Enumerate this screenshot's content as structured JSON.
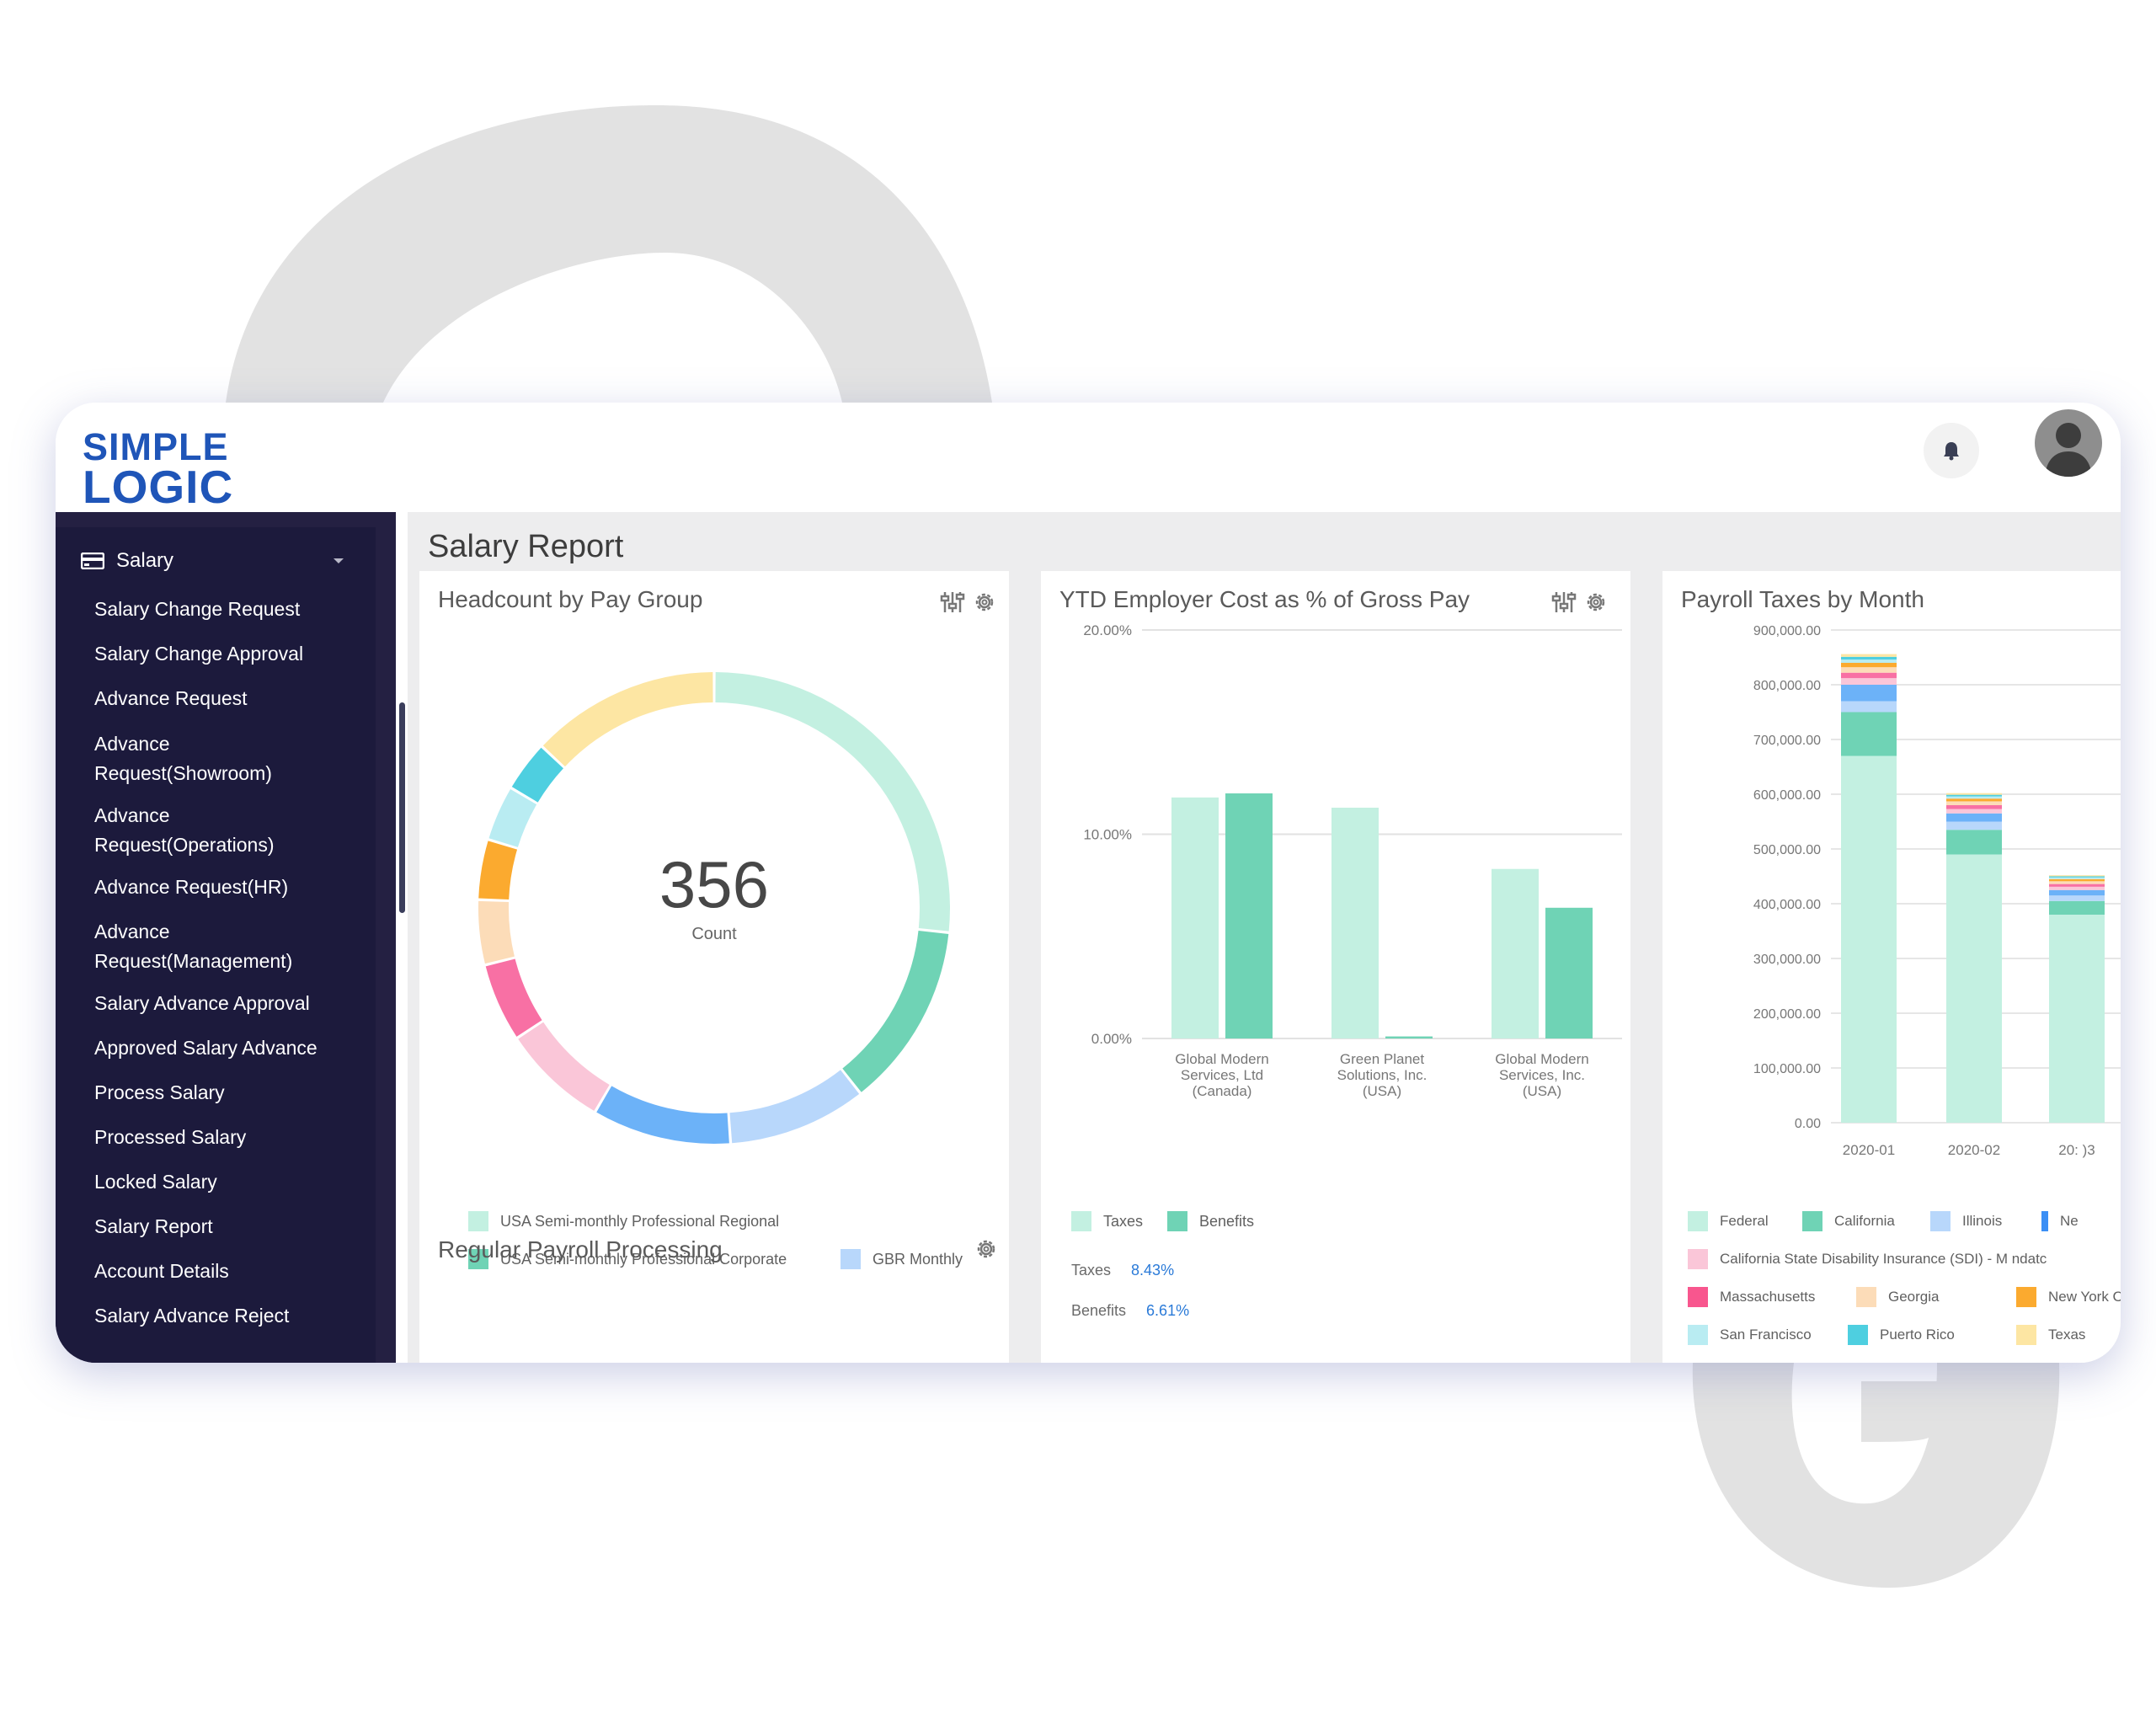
{
  "brand": {
    "line1": "SIMPLE",
    "line2": "LOGIC",
    "color": "#1f55b8"
  },
  "header": {
    "notifications_icon": "bell-icon",
    "avatar_icon": "user-avatar"
  },
  "sidebar": {
    "section": {
      "label": "Salary",
      "icon": "credit-card-icon"
    },
    "items": [
      {
        "label": "Salary Change Request"
      },
      {
        "label": "Salary Change Approval"
      },
      {
        "label": "Advance Request"
      },
      {
        "label": "Advance\nRequest(Showroom)"
      },
      {
        "label": "Advance\nRequest(Operations)"
      },
      {
        "label": "Advance Request(HR)"
      },
      {
        "label": "Advance\nRequest(Management)"
      },
      {
        "label": "Salary Advance Approval"
      },
      {
        "label": "Approved Salary Advance"
      },
      {
        "label": "Process Salary"
      },
      {
        "label": "Processed Salary"
      },
      {
        "label": "Locked Salary"
      },
      {
        "label": "Salary Report"
      },
      {
        "label": "Account Details"
      },
      {
        "label": "Salary Advance Reject"
      }
    ]
  },
  "main": {
    "title": "Salary Report",
    "panels": {
      "headcount": {
        "title": "Headcount by Pay Group",
        "center_value": "356",
        "center_label": "Count"
      },
      "employer_cost": {
        "title": "YTD Employer Cost as % of Gross Pay",
        "stats": [
          {
            "label": "Taxes",
            "value": "8.43%"
          },
          {
            "label": "Benefits",
            "value": "6.61%"
          }
        ]
      },
      "payroll_taxes": {
        "title": "Payroll Taxes by Month"
      },
      "regular_payroll": {
        "title": "Regular Payroll Processing"
      }
    }
  },
  "chart_data": [
    {
      "type": "pie",
      "title": "Headcount by Pay Group",
      "center": {
        "value": "356",
        "label": "Count"
      },
      "legend": [
        {
          "name": "USA Semi-monthly Professional Regional",
          "color": "#c3f0e1"
        },
        {
          "name": "USA Semi-monthly Professional Corporate",
          "color": "#6fd3b5"
        },
        {
          "name": "GBR Monthly",
          "color": "#b8d7fb"
        }
      ],
      "slices": [
        {
          "name": "USA Semi-monthly Professional Regional",
          "value": 84,
          "color": "#c3f0e1"
        },
        {
          "name": "USA Semi-monthly Professional Corporate",
          "value": 40,
          "color": "#6fd3b5"
        },
        {
          "name": "GBR Monthly",
          "value": 30,
          "color": "#b8d7fb"
        },
        {
          "name": "",
          "value": 30,
          "color": "#6cb2f8"
        },
        {
          "name": "",
          "value": 23,
          "color": "#fac6d8"
        },
        {
          "name": "",
          "value": 17,
          "color": "#f870a4"
        },
        {
          "name": "",
          "value": 14,
          "color": "#fcdcb8"
        },
        {
          "name": "",
          "value": 13,
          "color": "#fbaa2f"
        },
        {
          "name": "",
          "value": 12,
          "color": "#b9ecf2"
        },
        {
          "name": "",
          "value": 11,
          "color": "#4ecfe0"
        },
        {
          "name": "",
          "value": 41,
          "color": "#fde6a3"
        }
      ]
    },
    {
      "type": "bar",
      "title": "YTD Employer Cost as % of Gross Pay",
      "categories": [
        "Global Modern Services, Ltd (Canada)",
        "Green Planet Solutions, Inc. (USA)",
        "Global Modern Services, Inc. (USA)"
      ],
      "series": [
        {
          "name": "Taxes",
          "color": "#c3f0e1",
          "values": [
            11.8,
            11.3,
            8.3
          ]
        },
        {
          "name": "Benefits",
          "color": "#6fd3b5",
          "values": [
            12.0,
            0.1,
            6.4
          ]
        }
      ],
      "ylim": [
        0,
        20
      ],
      "yticks": [
        "0.00%",
        "10.00%",
        "20.00%"
      ]
    },
    {
      "type": "bar",
      "title": "Payroll Taxes by Month",
      "categories": [
        "2020-01",
        "2020-02",
        "20:   )3"
      ],
      "yticks": [
        "0.00",
        "100,000.00",
        "200,000.00",
        "300,000.00",
        "400,000.00",
        "500,000.00",
        "600,000.00",
        "700,000.00",
        "800,000.00",
        "900,000.00"
      ],
      "ylim": [
        0,
        900000
      ],
      "legend": [
        {
          "name": "Federal",
          "color": "#c3f0e1"
        },
        {
          "name": "California",
          "color": "#6fd3b5"
        },
        {
          "name": "Illinois",
          "color": "#b8d7fb"
        },
        {
          "name": "Ne",
          "color": "#3b8ff5"
        },
        {
          "name": "California State Disability Insurance (SDI) - M  ndatc",
          "color": "#fac6d8"
        },
        {
          "name": "Massachusetts",
          "color": "#f8568e"
        },
        {
          "name": "Georgia",
          "color": "#fcdcb8"
        },
        {
          "name": "New York C",
          "color": "#fbaa2f"
        },
        {
          "name": "San Francisco",
          "color": "#b9ecf2"
        },
        {
          "name": "Puerto Rico",
          "color": "#4ecfe0"
        },
        {
          "name": "Texas",
          "color": "#fde6a3"
        }
      ],
      "series": [
        {
          "name": "Federal",
          "color": "#c3f0e1",
          "values": [
            670000,
            490000,
            380000
          ]
        },
        {
          "name": "California",
          "color": "#6fd3b5",
          "values": [
            80000,
            45000,
            25000
          ]
        },
        {
          "name": "Illinois",
          "color": "#b8d7fb",
          "values": [
            20000,
            15000,
            10000
          ]
        },
        {
          "name": "Ne",
          "color": "#6cb2f8",
          "values": [
            30000,
            15000,
            10000
          ]
        },
        {
          "name": "California State Disability Insurance (SDI) - M  ndatc",
          "color": "#fac6d8",
          "values": [
            12000,
            8000,
            6000
          ]
        },
        {
          "name": "Massachusetts",
          "color": "#f870a4",
          "values": [
            10000,
            7000,
            5000
          ]
        },
        {
          "name": "Georgia",
          "color": "#fcdcb8",
          "values": [
            10000,
            7000,
            5000
          ]
        },
        {
          "name": "New York C",
          "color": "#fbaa2f",
          "values": [
            8000,
            5000,
            4000
          ]
        },
        {
          "name": "San Francisco",
          "color": "#b9ecf2",
          "values": [
            6000,
            4000,
            3000
          ]
        },
        {
          "name": "Puerto Rico",
          "color": "#4ecfe0",
          "values": [
            5000,
            3000,
            2000
          ]
        },
        {
          "name": "Texas",
          "color": "#fde6a3",
          "values": [
            5000,
            3000,
            2000
          ]
        }
      ]
    }
  ]
}
